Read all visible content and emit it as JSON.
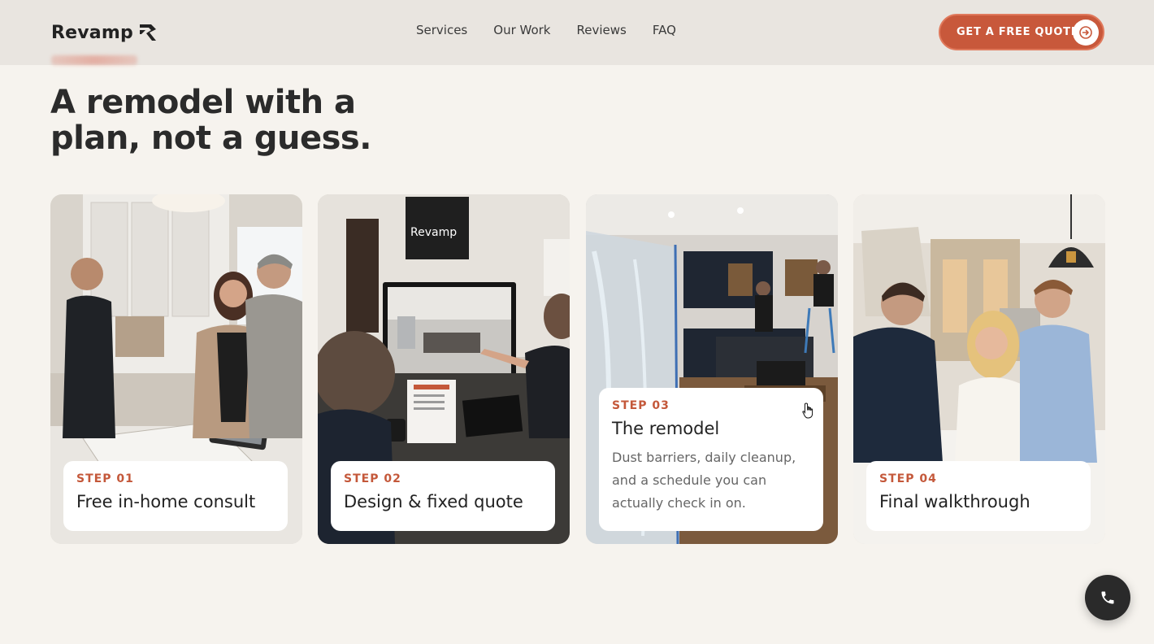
{
  "header": {
    "logo_text": "Revamp",
    "nav": [
      {
        "label": "Services"
      },
      {
        "label": "Our Work"
      },
      {
        "label": "Reviews"
      },
      {
        "label": "FAQ"
      }
    ],
    "cta_label": "GET A FREE QUOTE",
    "cta_icon": "arrow-right-circle-icon"
  },
  "hero": {
    "headline": "A remodel with a plan, not a guess."
  },
  "steps": [
    {
      "step": "STEP 01",
      "title": "Free in-home consult",
      "description": ""
    },
    {
      "step": "STEP 02",
      "title": "Design & fixed quote",
      "description": ""
    },
    {
      "step": "STEP 03",
      "title": "The remodel",
      "description": "Dust barriers, daily cleanup, and a schedule you can actually check in on."
    },
    {
      "step": "STEP 04",
      "title": "Final walkthrough",
      "description": ""
    }
  ],
  "photo_sign_text": "Revamp",
  "floating": {
    "phone_icon": "phone-icon"
  },
  "colors": {
    "accent": "#c8583b",
    "background": "#f6f3ee",
    "header_bg": "#e9e5e0",
    "step_label": "#c4583a",
    "fab": "#2a2a2a"
  }
}
